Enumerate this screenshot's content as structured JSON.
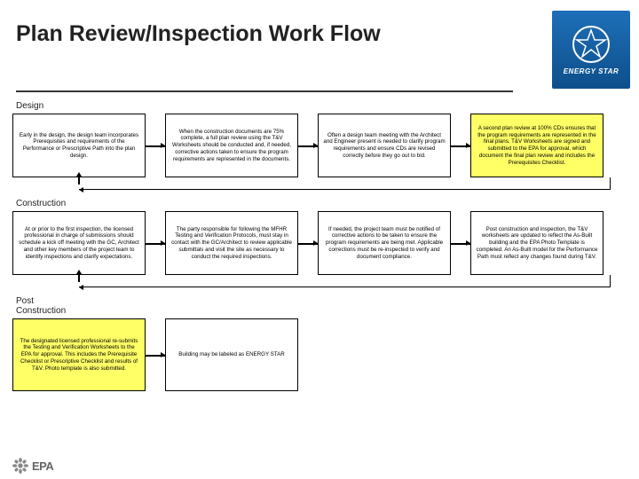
{
  "header": {
    "title": "Plan Review/Inspection Work Flow"
  },
  "logo": {
    "text": "ENERGY STAR"
  },
  "sections": {
    "design": "Design",
    "construction": "Construction",
    "post": "Post Construction"
  },
  "design_row": [
    "Early in the design, the design team incorporates Prerequisites and requirements of the Performance or Prescriptive Path into the plan design.",
    "When the construction documents are 75% complete, a full plan review using the T&V Worksheets should be conducted and, if needed, corrective actions taken to ensure the program requirements are represented in the documents.",
    "Often a design team meeting with the Architect and Engineer present is needed to clarify program requirements and ensure CDs are revised correctly before they go out to bid.",
    "A second plan review at 100% CDs ensures that the program requirements are represented in the final plans. T&V Worksheets are signed and submitted to the EPA for approval, which document the final plan review and includes the Prerequisites Checklist."
  ],
  "construction_row": [
    "At or prior to the first inspection, the licensed professional in charge of submissions should schedule a kick off meeting with the GC, Architect and other key members of the project team to identify inspections and clarify expectations.",
    "The party responsible for following the MFHR Testing and Verification Protocols, must stay in contact with the GC/Architect to review applicable submittals and visit the site as necessary to conduct the required inspections.",
    "If needed, the project team must be notified of corrective actions to be taken to ensure the program requirements are being met. Applicable corrections must be re-inspected to verify and document compliance.",
    "Post construction and inspection, the T&V worksheets are updated to reflect the As-Built building and the EPA Photo Template is completed. An As-Built model for the Performance Path must reflect any changes found during T&V."
  ],
  "post_row": [
    "The designated licensed professional re-submits the Testing and Verification Worksheets to the EPA for approval. This includes the Prerequisite Checklist or Prescriptive Checklist and results of T&V. Photo template is also submitted.",
    "Building may be labeled as ENERGY STAR"
  ],
  "footer": {
    "epa": "EPA"
  }
}
